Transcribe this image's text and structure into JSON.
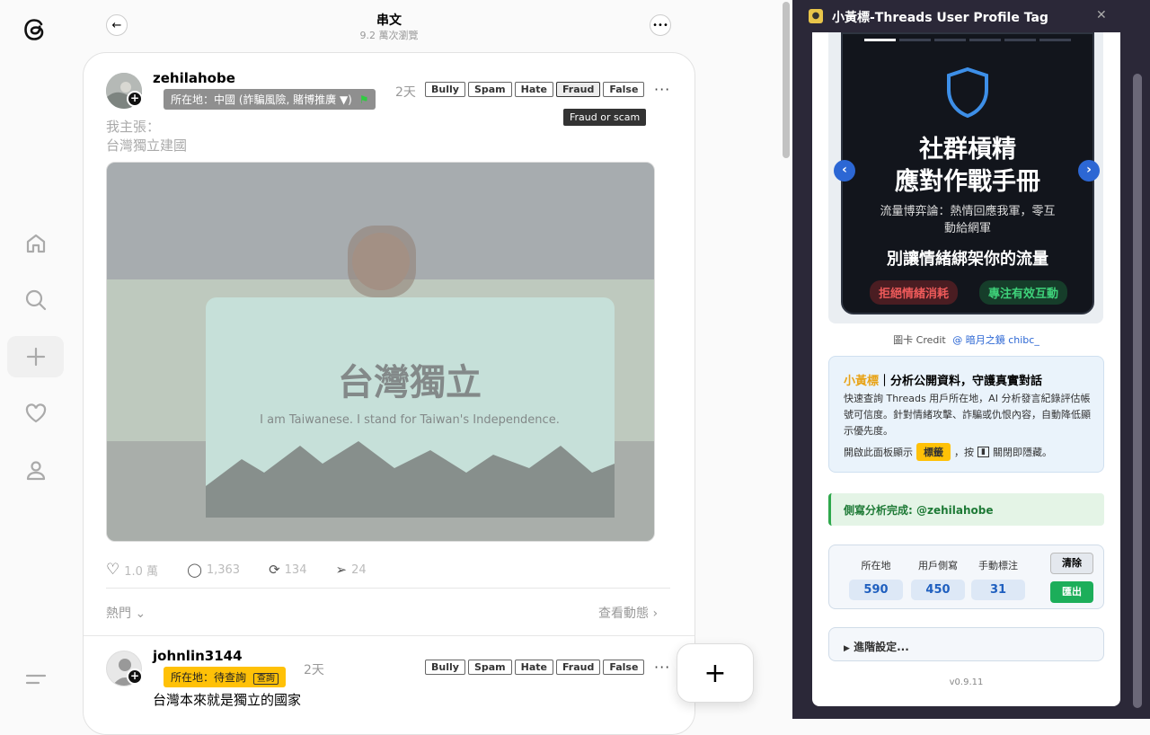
{
  "header": {
    "title": "串文",
    "views": "9.2 萬次瀏覽"
  },
  "post1": {
    "username": "zehilahobe",
    "location": "所在地：中國 (詐騙風險, 賭博推廣 ▼)",
    "time": "2天",
    "tags": [
      "Bully",
      "Spam",
      "Hate",
      "Fraud",
      "False"
    ],
    "tooltip": "Fraud or scam",
    "text_line1": "我主張：",
    "text_line2": "台灣獨立建國",
    "photo_banner": "台灣獨立",
    "photo_text": "I am Taiwanese. I stand for Taiwan's Independence.",
    "likes": "1.0 萬",
    "comments": "1,363",
    "reposts": "134",
    "shares": "24",
    "sort": "熱門",
    "view_activity": "查看動態"
  },
  "post2": {
    "username": "johnlin3144",
    "location": "所在地：待查詢",
    "query_btn": "查詢",
    "time": "2天",
    "tags": [
      "Bully",
      "Spam",
      "Hate",
      "Fraud",
      "False"
    ],
    "text": "台灣本來就是獨立的國家"
  },
  "panel": {
    "title": "小黃標-Threads User Profile Tag",
    "slide": {
      "title1": "社群槓精",
      "title2": "應對作戰手冊",
      "sub1": "流量博弈論：熱情回應我軍，零互",
      "sub2": "動給網軍",
      "headline": "別讓情緒綁架你的流量",
      "pill_red": "拒絕情緒消耗",
      "pill_green": "專注有效互動"
    },
    "credit_prefix": "圖卡 Credit",
    "credit_link": "@ 暗月之鏡 chibc_",
    "info": {
      "brand": "小黃標",
      "title": "｜分析公開資料，守護真實對話",
      "desc": "快速查詢 Threads 用戶所在地，AI 分析發言紀錄評估帳號可信度。針對情緒攻擊、詐騙或仇恨內容，自動降低顯示優先度。",
      "hint_pre": "開啟此面板顯示",
      "hint_tag": "標籤",
      "hint_post": "，按",
      "hint_end": "關閉即隱藏。"
    },
    "done": "側寫分析完成: @zehilahobe",
    "stats": [
      {
        "label": "所在地",
        "value": "590"
      },
      {
        "label": "用戶側寫",
        "value": "450"
      },
      {
        "label": "手動標注",
        "value": "31"
      }
    ],
    "clear": "清除",
    "export": "匯出",
    "advanced": "進階設定...",
    "version": "v0.9.11"
  }
}
